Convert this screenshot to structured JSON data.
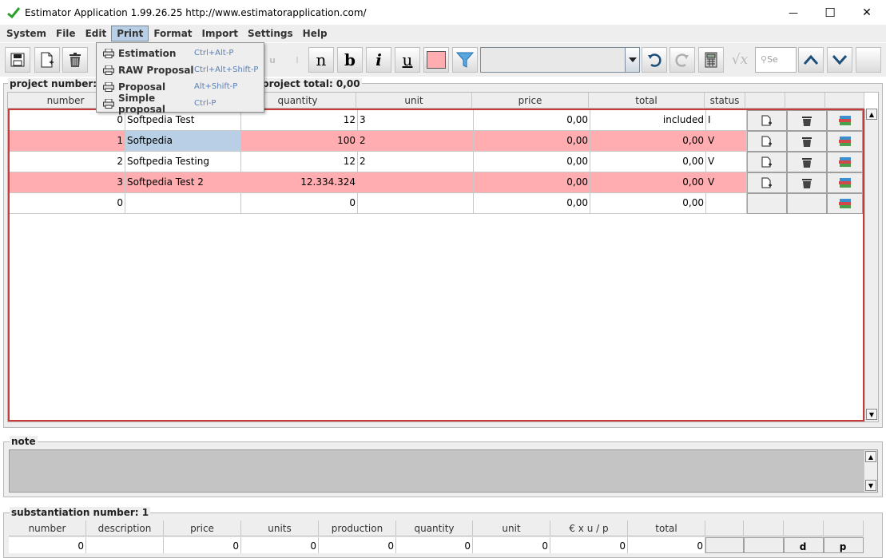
{
  "window": {
    "title": "Estimator Application 1.99.26.25 http://www.estimatorapplication.com/",
    "controls": {
      "minimize": "—",
      "maximize": "☐",
      "close": "✕"
    }
  },
  "menubar": {
    "items": [
      "System",
      "File",
      "Edit",
      "Print",
      "Format",
      "Import",
      "Settings",
      "Help"
    ],
    "active": "Print"
  },
  "print_menu": {
    "items": [
      {
        "label": "Estimation",
        "shortcut": "Ctrl+Alt-P",
        "icon": "printer-icon"
      },
      {
        "label": "RAW Proposal",
        "shortcut": "Ctrl+Alt+Shift-P",
        "icon": "printer-icon"
      },
      {
        "label": "Proposal",
        "shortcut": "Alt+Shift-P",
        "icon": "printer-icon"
      },
      {
        "label": "Simple proposal",
        "shortcut": "Ctrl-P",
        "icon": "printer-icon"
      }
    ]
  },
  "toolbar": {
    "letters": {
      "u_faded": "u",
      "i_faded": "I",
      "n": "n",
      "b": "b",
      "i": "i",
      "u": "u"
    },
    "format_combo_value": "",
    "search_placeholder": "Se",
    "highlight_color": "#ffadb0",
    "icons": [
      "save-icon",
      "new-document-icon",
      "delete-icon",
      "filter-icon",
      "undo-icon",
      "redo-icon",
      "calculator-icon",
      "sqrt-icon",
      "search-icon",
      "move-up-icon",
      "move-down-icon"
    ]
  },
  "project": {
    "number_label": "project number: 0 c",
    "total_label": "project total: 0,00"
  },
  "main_table": {
    "columns": [
      "number",
      "",
      "quantity",
      "unit",
      "price",
      "total",
      "status"
    ],
    "rows": [
      {
        "number": "0",
        "description": "Softpedia Test",
        "quantity": "12",
        "unit": "3",
        "price": "0,00",
        "total": "included",
        "status": "I",
        "pink": false
      },
      {
        "number": "1",
        "description": "Softpedia",
        "quantity": "100",
        "unit": "2",
        "price": "0,00",
        "total": "0,00",
        "status": "V",
        "pink": true
      },
      {
        "number": "2",
        "description": "Softpedia Testing",
        "quantity": "12",
        "unit": "2",
        "price": "0,00",
        "total": "0,00",
        "status": "V",
        "pink": false
      },
      {
        "number": "3",
        "description": "Softpedia Test 2",
        "quantity": "12.334.324",
        "unit": "",
        "price": "0,00",
        "total": "0,00",
        "status": "V",
        "pink": true
      },
      {
        "number": "0",
        "description": "",
        "quantity": "0",
        "unit": "",
        "price": "0,00",
        "total": "0,00",
        "status": "",
        "pink": false
      }
    ]
  },
  "note": {
    "label": "note",
    "text": ""
  },
  "substantiation": {
    "label": "substantiation number: 1",
    "columns": [
      "number",
      "description",
      "price",
      "units",
      "production",
      "quantity",
      "unit",
      "€ x u / p",
      "total"
    ],
    "row": [
      "0",
      "",
      "0",
      "0",
      "0",
      "0",
      "0",
      "0",
      "0"
    ],
    "action_labels": [
      "d",
      "p"
    ]
  },
  "colors": {
    "row_pink": "#ffadb0",
    "selection": "#b8cfe5",
    "table_border": "#c93a3a",
    "shortcut_text": "#5a7fb5"
  }
}
